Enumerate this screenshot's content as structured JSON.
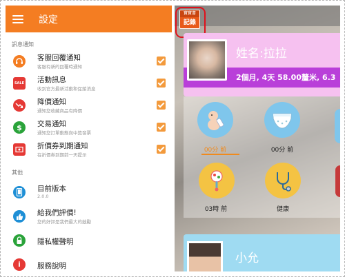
{
  "settings": {
    "title": "設定",
    "notifications_section": "訊息通知",
    "other_section": "其他",
    "items": [
      {
        "title": "客服回覆通知",
        "subtitle": "客服有新的回覆時通知",
        "icon": "headset-icon",
        "color": "#f47d22"
      },
      {
        "title": "活動訊息",
        "subtitle": "收到官方最新活動和促銷消息",
        "icon": "sale-icon",
        "color": "#e53935"
      },
      {
        "title": "降價通知",
        "subtitle": "通知您收藏商品有降價",
        "icon": "price-drop-icon",
        "color": "#e53935"
      },
      {
        "title": "交易通知",
        "subtitle": "通知您訂單動態與中獎發票",
        "icon": "dollar-icon",
        "color": "#2aa33a"
      },
      {
        "title": "折價券到期通知",
        "subtitle": "在折價券到期前一天提示",
        "icon": "coupon-icon",
        "color": "#e53935"
      }
    ],
    "other_items": [
      {
        "title": "目前版本",
        "subtitle": "2.0.0",
        "icon": "tablet-icon",
        "color": "#1e8fd6"
      },
      {
        "title": "給我們評價!",
        "subtitle": "您的好評是我們最大的鼓勵",
        "icon": "thumbs-up-icon",
        "color": "#1e8fd6"
      },
      {
        "title": "隱私權聲明",
        "icon": "lock-icon",
        "color": "#2aa33a"
      },
      {
        "title": "服務說明",
        "icon": "info-icon",
        "color": "#e53935"
      }
    ]
  },
  "app": {
    "badge_top": "寶寶書",
    "badge_bottom": "記錄",
    "child1": {
      "name": "姓名:拉拉",
      "info": "2個月, 4天 58.00釐米, 6.3"
    },
    "tiles": [
      {
        "label": "00分 前",
        "icon": "feeding-icon",
        "selected": true
      },
      {
        "label": "00分 前",
        "icon": "diaper-icon",
        "selected": false
      },
      {
        "label": "03時 前",
        "icon": "rattle-icon",
        "selected": false
      },
      {
        "label": "健康",
        "icon": "stethoscope-icon",
        "selected": false
      }
    ],
    "child2": {
      "name": "小允"
    }
  }
}
